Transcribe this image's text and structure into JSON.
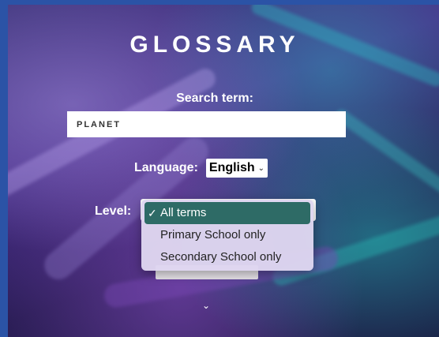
{
  "page": {
    "title": "GLOSSARY"
  },
  "search": {
    "label": "Search term:",
    "value": "PLANET"
  },
  "language": {
    "label": "Language:",
    "selected": "English"
  },
  "level": {
    "label": "Level:",
    "options": [
      {
        "label": "All terms",
        "selected": true
      },
      {
        "label": "Primary School only",
        "selected": false
      },
      {
        "label": "Secondary School only",
        "selected": false
      }
    ]
  },
  "icons": {
    "check": "checkmark-icon",
    "dropdown": "chevron-down-icon",
    "scroll": "chevron-down-icon"
  },
  "colors": {
    "frame": "#2b53a6",
    "selected_option": "#2e6b66"
  }
}
